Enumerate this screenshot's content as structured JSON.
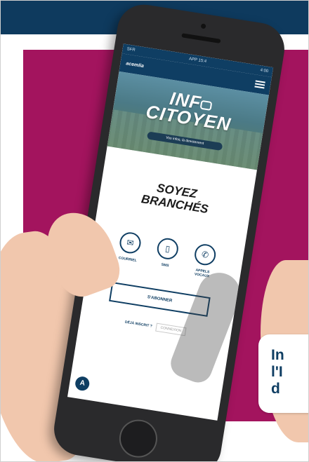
{
  "phone": {
    "status_carrier": "SFR",
    "status_time": "APP 15:4",
    "status_battery": "4:00",
    "app_logo": "acemlia",
    "banner_title_line1": "INF",
    "banner_title_line2": "CITOYEN",
    "banner_tagline": "Vos infos, là directement",
    "headline_line1": "SOYEZ",
    "headline_line2": "BRANCHÉS",
    "options": [
      {
        "icon": "email-icon",
        "glyph": "✉",
        "label": "COURRIEL"
      },
      {
        "icon": "sms-icon",
        "glyph": "▯",
        "label": "SMS"
      },
      {
        "icon": "phone-icon",
        "glyph": "✆",
        "label": "APPELS VOCAUX"
      }
    ],
    "subscribe_label": "S'ABONNER",
    "already_label": "DÉJÀ INSCRIT ?",
    "connect_label": "CONNEXION",
    "fab_label": "A"
  },
  "bubble": {
    "line1": "In",
    "line2": "l'I",
    "line3": "d"
  },
  "colors": {
    "navy": "#0e3a5e",
    "magenta": "#a3145e"
  }
}
